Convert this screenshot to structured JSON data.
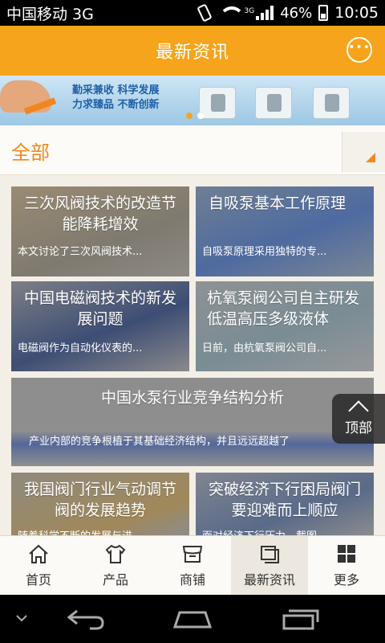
{
  "status_bar": {
    "carrier": "中国移动 3G",
    "network": "3G",
    "battery": "46%",
    "time": "10:05"
  },
  "header": {
    "title": "最新资讯",
    "chat_icon": "chat-bubble-icon"
  },
  "banner": {
    "slogan_line1": "勤采兼收 科学发展",
    "slogan_line2": "力求臻品 不断创新"
  },
  "category": {
    "label": "全部"
  },
  "articles": [
    {
      "title": "三次风阀技术的改造节能降耗增效",
      "desc": "本文讨论了三次风阀技术..."
    },
    {
      "title": "自吸泵基本工作原理",
      "desc": "自吸泵原理采用独特的专..."
    },
    {
      "title": "中国电磁阀技术的新发展问题",
      "desc": "电磁阀作为自动化仪表的..."
    },
    {
      "title": "杭氧泵阀公司自主研发低温高压多级液体",
      "desc": "日前，由杭氧泵阀公司自..."
    },
    {
      "title": "中国水泵行业竞争结构分析",
      "desc": "产业内部的竞争根植于其基础经济结构，并且远远超越了"
    },
    {
      "title": "我国阀门行业气动调节阀的发展趋势",
      "desc": "随着科学不断的发展与进..."
    },
    {
      "title": "突破经济下行困局阀门要迎难而上顺应",
      "desc": "面对经济下行压力，截图..."
    }
  ],
  "back_to_top": {
    "label": "顶部"
  },
  "tabs": [
    {
      "label": "首页",
      "icon": "home-icon"
    },
    {
      "label": "产品",
      "icon": "shirt-icon"
    },
    {
      "label": "商铺",
      "icon": "store-icon"
    },
    {
      "label": "最新资讯",
      "icon": "news-icon",
      "active": true
    },
    {
      "label": "更多",
      "icon": "grid-icon"
    }
  ],
  "colors": {
    "accent": "#f6a41b",
    "category_text": "#f08a1c"
  }
}
